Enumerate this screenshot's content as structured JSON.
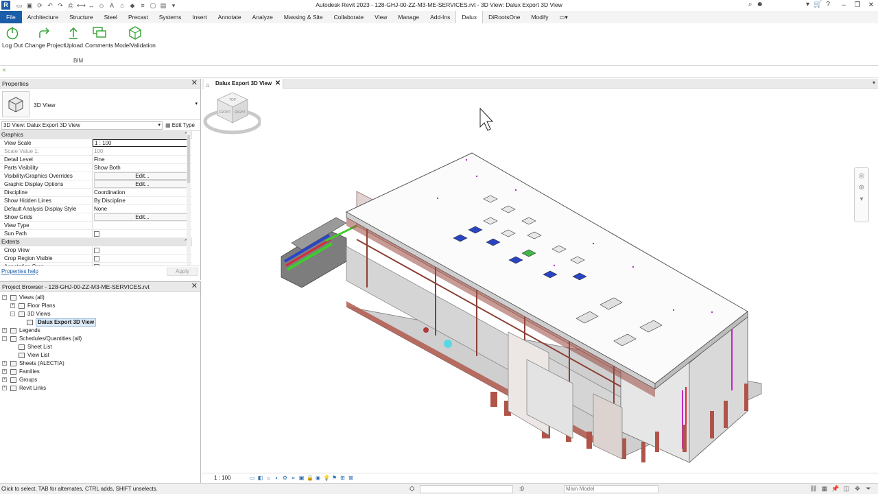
{
  "window": {
    "title": "Autodesk Revit 2023 - 128-GHJ-00-ZZ-M3-ME-SERVICES.rvt - 3D View: Dalux Export 3D View",
    "app_logo": "R"
  },
  "ribbon": {
    "tabs": [
      "File",
      "Architecture",
      "Structure",
      "Steel",
      "Precast",
      "Systems",
      "Insert",
      "Annotate",
      "Analyze",
      "Massing & Site",
      "Collaborate",
      "View",
      "Manage",
      "Add-Ins",
      "Dalux",
      "DiRootsOne",
      "Modify"
    ],
    "active_tab": "Dalux",
    "buttons": [
      {
        "label": "Log Out",
        "icon": "power-icon"
      },
      {
        "label": "Change Project",
        "icon": "change-project-icon"
      },
      {
        "label": "Upload",
        "icon": "upload-icon"
      },
      {
        "label": "Comments",
        "icon": "comments-icon"
      },
      {
        "label": "ModelValidation",
        "icon": "model-validation-icon"
      }
    ],
    "panel_label": "BIM",
    "accent_color": "#3aa63a"
  },
  "properties": {
    "header": "Properties",
    "type_name": "3D View",
    "instance_selector": "3D View: Dalux Export 3D View",
    "edit_type": "Edit Type",
    "groups": [
      {
        "name": "Graphics",
        "rows": [
          {
            "name": "View Scale",
            "value": "1 : 100"
          },
          {
            "name": "Scale Value    1:",
            "value": "100"
          },
          {
            "name": "Detail Level",
            "value": "Fine"
          },
          {
            "name": "Parts Visibility",
            "value": "Show Both"
          },
          {
            "name": "Visibility/Graphics Overrides",
            "value": "Edit..."
          },
          {
            "name": "Graphic Display Options",
            "value": "Edit..."
          },
          {
            "name": "Discipline",
            "value": "Coordination"
          },
          {
            "name": "Show Hidden Lines",
            "value": "By Discipline"
          },
          {
            "name": "Default Analysis Display Style",
            "value": "None"
          },
          {
            "name": "Show Grids",
            "value": "Edit..."
          },
          {
            "name": "View Type",
            "value": ""
          },
          {
            "name": "Sun Path",
            "value": ""
          }
        ]
      },
      {
        "name": "Extents",
        "rows": [
          {
            "name": "Crop View",
            "value": ""
          },
          {
            "name": "Crop Region Visible",
            "value": ""
          },
          {
            "name": "Annotation Crop",
            "value": ""
          }
        ]
      }
    ],
    "help_link": "Properties help",
    "apply": "Apply"
  },
  "browser": {
    "header": "Project Browser - 128-GHJ-00-ZZ-M3-ME-SERVICES.rvt",
    "nodes": [
      {
        "label": "Views (all)",
        "level": 0,
        "expander": "-"
      },
      {
        "label": "Floor Plans",
        "level": 1,
        "expander": "+"
      },
      {
        "label": "3D Views",
        "level": 1,
        "expander": "-"
      },
      {
        "label": "Dalux Export 3D View",
        "level": 2,
        "expander": "",
        "selected": true
      },
      {
        "label": "Legends",
        "level": 0,
        "expander": "+"
      },
      {
        "label": "Schedules/Quantities (all)",
        "level": 0,
        "expander": "-"
      },
      {
        "label": "Sheet List",
        "level": 1,
        "expander": ""
      },
      {
        "label": "View List",
        "level": 1,
        "expander": ""
      },
      {
        "label": "Sheets (ALECTIA)",
        "level": 0,
        "expander": "+"
      },
      {
        "label": "Families",
        "level": 0,
        "expander": "+"
      },
      {
        "label": "Groups",
        "level": 0,
        "expander": "+"
      },
      {
        "label": "Revit Links",
        "level": 0,
        "expander": "+"
      }
    ]
  },
  "document": {
    "tab_label": "Dalux Export 3D View",
    "scale": "1 : 100"
  },
  "viewcube": {
    "faces": [
      "TOP",
      "FRONT",
      "RIGHT"
    ]
  },
  "status": {
    "text": "Click to select, TAB for alternates, CTRL adds, SHIFT unselects.",
    "zero": ":0",
    "model": "Main Model"
  }
}
